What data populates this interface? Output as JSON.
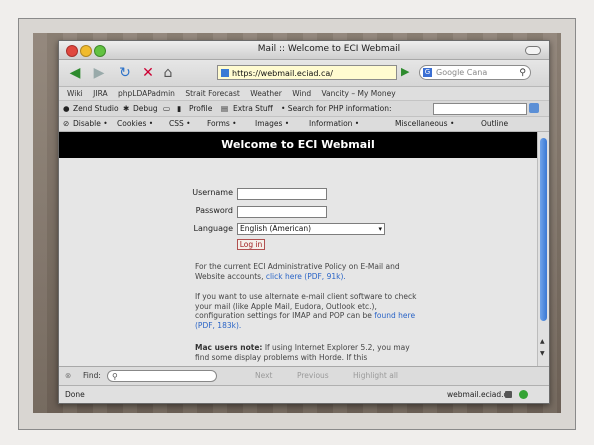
{
  "window": {
    "title": "Mail :: Welcome to ECI Webmail"
  },
  "navbar": {
    "url": "https://webmail.eciad.ca/",
    "search_placeholder": "Google Cana"
  },
  "bookmarks": [
    "Wiki",
    "JIRA",
    "phpLDAPadmin",
    "Strait Forecast",
    "Weather",
    "Wind",
    "Vancity – My Money"
  ],
  "devbar": {
    "zend": "Zend Studio",
    "debug": "Debug",
    "profile": "Profile",
    "extra": "Extra Stuff",
    "search_label": "• Search for PHP information:"
  },
  "webdevbar": {
    "disable": "Disable •",
    "cookies": "Cookies •",
    "css": "CSS •",
    "forms": "Forms •",
    "images": "Images •",
    "information": "Information •",
    "misc": "Miscellaneous •",
    "outline": "Outline"
  },
  "page": {
    "header": "Welcome to ECI Webmail",
    "username_label": "Username",
    "password_label": "Password",
    "language_label": "Language",
    "language_value": "English (American)",
    "login_button": "Log in",
    "policy_text": "For the current ECI Administrative Policy on E-Mail and Website accounts,",
    "policy_link": "click here (PDF, 91k).",
    "client_text": "If you want to use alternate e-mail client software to check your mail (like Apple Mail, Eudora, Outlook etc.), configuration settings for IMAP and POP can be",
    "client_link": "found here (PDF, 183k).",
    "mac_bold": "Mac users note:",
    "mac_text": "If using Internet Explorer 5.2, you may find some display problems with Horde. If this"
  },
  "findbar": {
    "label": "Find:",
    "next": "Next",
    "previous": "Previous",
    "highlight": "Highlight all"
  },
  "status": {
    "left": "Done",
    "domain": "webmail.eciad.ca"
  }
}
